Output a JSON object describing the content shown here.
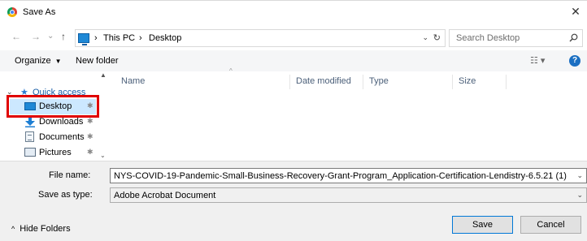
{
  "window": {
    "title": "Save As",
    "close_glyph": "✕"
  },
  "nav": {
    "back_glyph": "←",
    "forward_glyph": "→",
    "recent_glyph": "⌄",
    "up_glyph": "↑",
    "breadcrumb_sep_1": "›",
    "crumb_1": "This PC",
    "breadcrumb_sep_2": "›",
    "crumb_2": "Desktop",
    "dropdown_glyph": "⌄",
    "refresh_glyph": "↻",
    "search_placeholder": "Search Desktop"
  },
  "toolbar": {
    "organize_label": "Organize",
    "caret": "▼",
    "new_folder_label": "New folder",
    "view_glyph": "☷ ▾",
    "help_glyph": "?"
  },
  "sidebar": {
    "quick_access": {
      "label": "Quick access",
      "expand_glyph": "⌄",
      "icon": "star-icon",
      "star_glyph": "★"
    },
    "items": [
      {
        "label": "Desktop",
        "icon": "desktop-icon",
        "pin": "📌"
      },
      {
        "label": "Downloads",
        "icon": "download-icon",
        "pin": "📌"
      },
      {
        "label": "Documents",
        "icon": "documents-icon",
        "pin": "📌"
      },
      {
        "label": "Pictures",
        "icon": "pictures-icon",
        "pin": "📌"
      }
    ],
    "scroll_up": "▲",
    "scroll_down": "⌄"
  },
  "columns": {
    "name": "Name",
    "date_modified": "Date modified",
    "type": "Type",
    "size": "Size",
    "sort_glyph": "^"
  },
  "form": {
    "file_name_label": "File name:",
    "file_name_value": "NYS-COVID-19-Pandemic-Small-Business-Recovery-Grant-Program_Application-Certification-Lendistry-6.5.21 (1)",
    "save_as_type_label": "Save as type:",
    "save_as_type_value": "Adobe Acrobat Document",
    "chevron": "⌄"
  },
  "footer": {
    "hide_folders_label": "Hide Folders",
    "hide_caret": "^",
    "save_label": "Save",
    "cancel_label": "Cancel"
  },
  "colors": {
    "selection": "#cce8ff",
    "highlight_border": "#e00000",
    "accent": "#0078d7"
  }
}
